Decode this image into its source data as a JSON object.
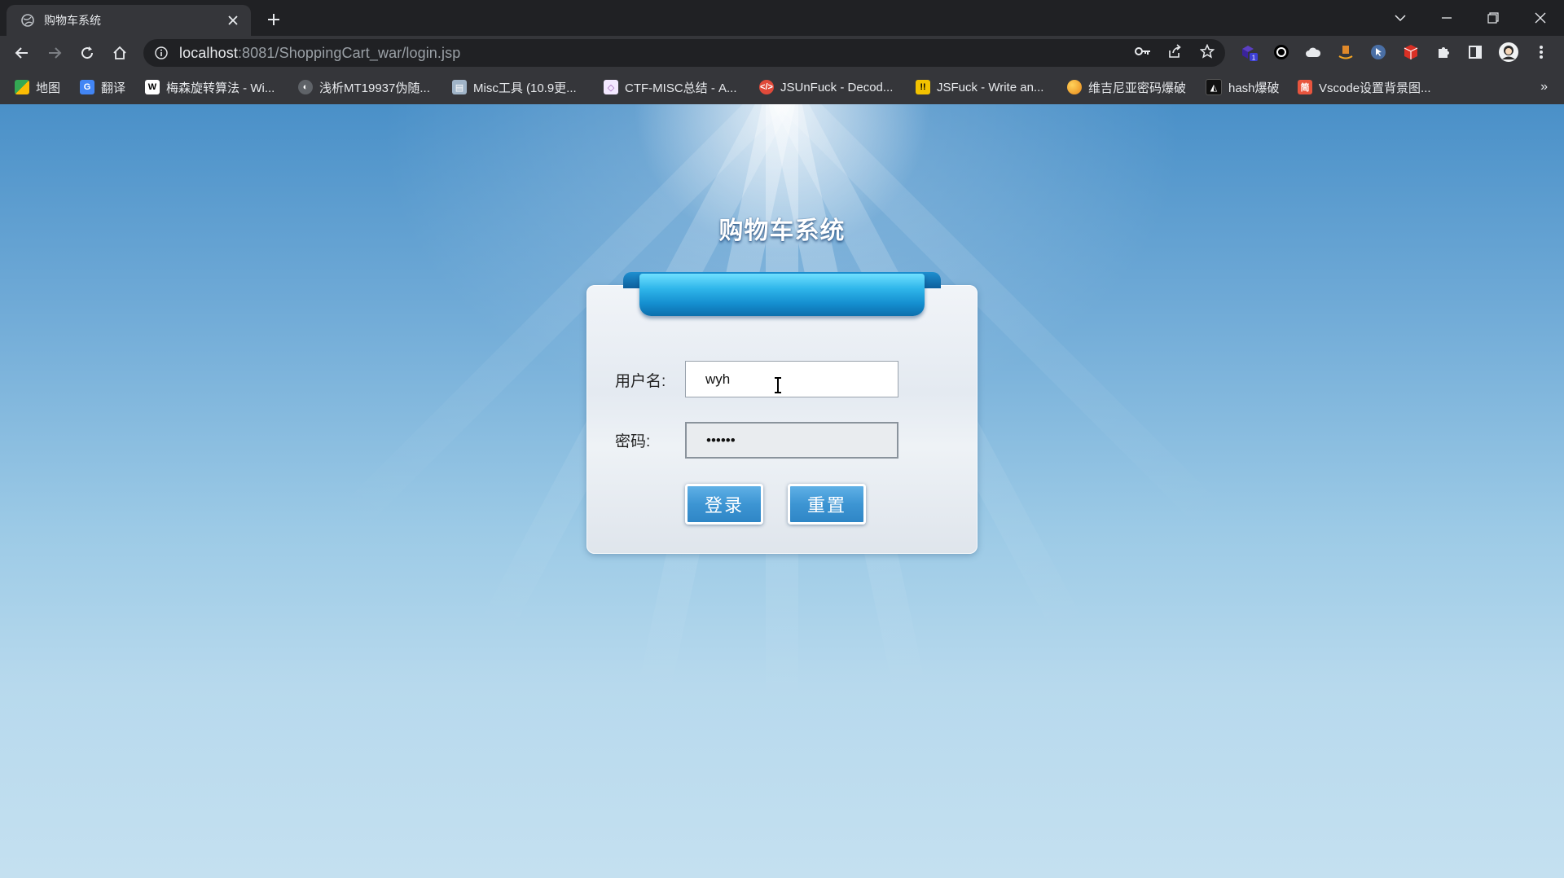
{
  "browser": {
    "tab_title": "购物车系统",
    "url_host": "localhost",
    "url_rest": ":8081/ShoppingCart_war/login.jsp",
    "extension_badge": "1",
    "bookmarks": [
      {
        "label": "地图",
        "icon": "maps-icon",
        "color": "#34a853"
      },
      {
        "label": "翻译",
        "icon": "translate-icon",
        "color": "#4285f4"
      },
      {
        "label": "梅森旋转算法 - Wi...",
        "icon": "wikipedia-icon",
        "color": "#ffffff"
      },
      {
        "label": "浅析MT19937伪随...",
        "icon": "globe-icon",
        "color": "#9aa0a6"
      },
      {
        "label": "Misc工具 (10.9更...",
        "icon": "doc-icon",
        "color": "#a0b4c8"
      },
      {
        "label": "CTF-MISC总结 - A...",
        "icon": "shield-icon",
        "color": "#d7c3f0"
      },
      {
        "label": "JSUnFuck - Decod...",
        "icon": "code-icon",
        "color": "#e04a3a"
      },
      {
        "label": "JSFuck - Write an...",
        "icon": "jsfuck-icon",
        "color": "#f2c200"
      },
      {
        "label": "维吉尼亚密码爆破",
        "icon": "orb-icon",
        "color": "#f0a020"
      },
      {
        "label": "hash爆破",
        "icon": "hash-icon",
        "color": "#111111"
      },
      {
        "label": "Vscode设置背景图...",
        "icon": "jianshu-icon",
        "color": "#e8553e"
      }
    ],
    "bookmarks_more": "»"
  },
  "page": {
    "title": "购物车系统",
    "username_label": "用户名:",
    "username_value": "wyh",
    "password_label": "密码:",
    "password_value": "••••••",
    "login_button": "登录",
    "reset_button": "重置"
  }
}
